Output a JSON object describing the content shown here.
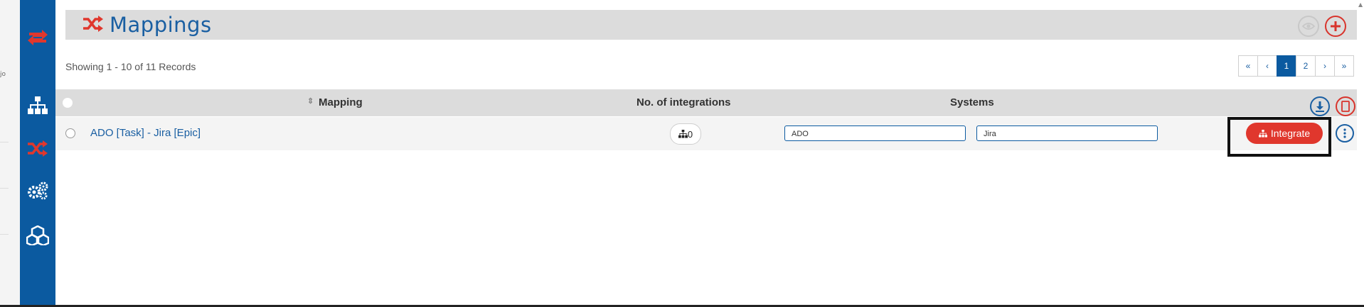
{
  "left_strip": {
    "fragment": "jo"
  },
  "sidebar": {
    "items": [
      {
        "name": "sync-arrows",
        "icon": "sync-icon",
        "color": "#e0372d"
      },
      {
        "name": "hierarchy",
        "icon": "sitemap-icon",
        "color": "#ffffff"
      },
      {
        "name": "mappings",
        "icon": "shuffle-icon",
        "color": "#e0372d"
      },
      {
        "name": "settings",
        "icon": "gears-icon",
        "color": "#ffffff"
      },
      {
        "name": "cubes",
        "icon": "cubes-icon",
        "color": "#ffffff"
      }
    ]
  },
  "header": {
    "title": "Mappings",
    "icon": "shuffle-icon"
  },
  "records_text": "Showing 1 - 10 of 11 Records",
  "pagination": {
    "first": "«",
    "prev": "‹",
    "pages": [
      "1",
      "2"
    ],
    "active_page": "1",
    "next": "›",
    "last": "»"
  },
  "table": {
    "columns": {
      "mapping": "Mapping",
      "integrations": "No. of integrations",
      "systems": "Systems"
    },
    "rows": [
      {
        "mapping": "ADO [Task] - Jira [Epic]",
        "integrations": "0",
        "systems": [
          "ADO",
          "Jira"
        ],
        "action": "Integrate"
      }
    ]
  },
  "colors": {
    "brand_blue": "#0b5aa0",
    "accent_red": "#e0372d",
    "header_gray": "#dcdcdc"
  }
}
